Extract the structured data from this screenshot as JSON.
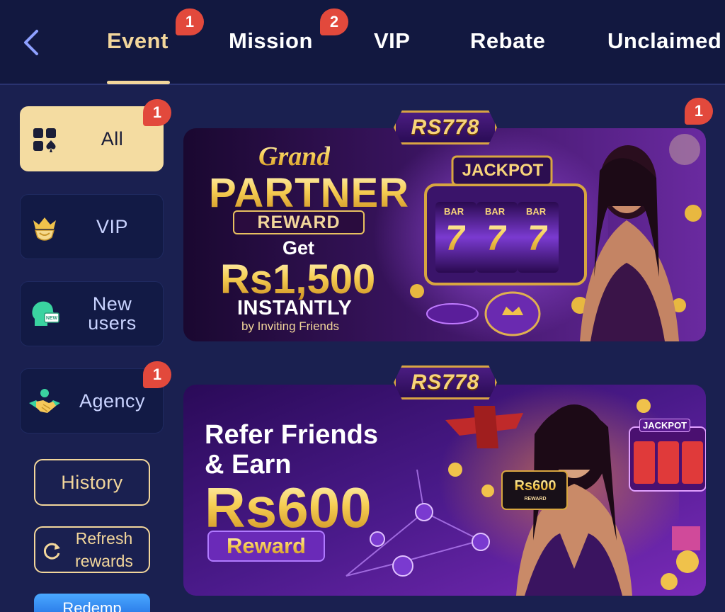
{
  "header": {
    "tabs": [
      {
        "label": "Event",
        "badge": "1",
        "active": true
      },
      {
        "label": "Mission",
        "badge": "2"
      },
      {
        "label": "VIP"
      },
      {
        "label": "Rebate"
      },
      {
        "label": "Unclaimed"
      }
    ]
  },
  "sidebar": {
    "items": [
      {
        "label": "All",
        "badge": "1",
        "icon": "grid-icon",
        "active": true
      },
      {
        "label": "VIP",
        "icon": "crown-shield-icon"
      },
      {
        "label": "New users",
        "icon": "new-user-head-icon"
      },
      {
        "label": "Agency",
        "badge": "1",
        "icon": "handshake-icon"
      }
    ],
    "history_label": "History",
    "refresh_label": "Refresh rewards",
    "redeem_label": "Redemp"
  },
  "banners": [
    {
      "badge": "1",
      "brand": "RS778",
      "line1": "Grand",
      "line2": "PARTNER",
      "line3": "REWARD",
      "line4": "Get",
      "line5": "Rs1,500",
      "line6": "INSTANTLY",
      "line7": "by Inviting Friends",
      "jackpot": "JACKPOT",
      "reel_labels": [
        "BAR",
        "BAR",
        "BAR"
      ],
      "reel_symbols": [
        "7",
        "7",
        "7"
      ]
    },
    {
      "brand": "RS778",
      "line1": "Refer Friends",
      "line2": "& Earn",
      "line3": "Rs600",
      "line4": "Reward",
      "card_amount": "Rs600",
      "card_caption": "REWARD",
      "jackpot": "JACKPOT"
    }
  ],
  "colors": {
    "background": "#1a2050",
    "header": "#121840",
    "accent_gold": "#f2d69b",
    "badge_red": "#e2493c",
    "sidebar_item": "#121a45"
  }
}
